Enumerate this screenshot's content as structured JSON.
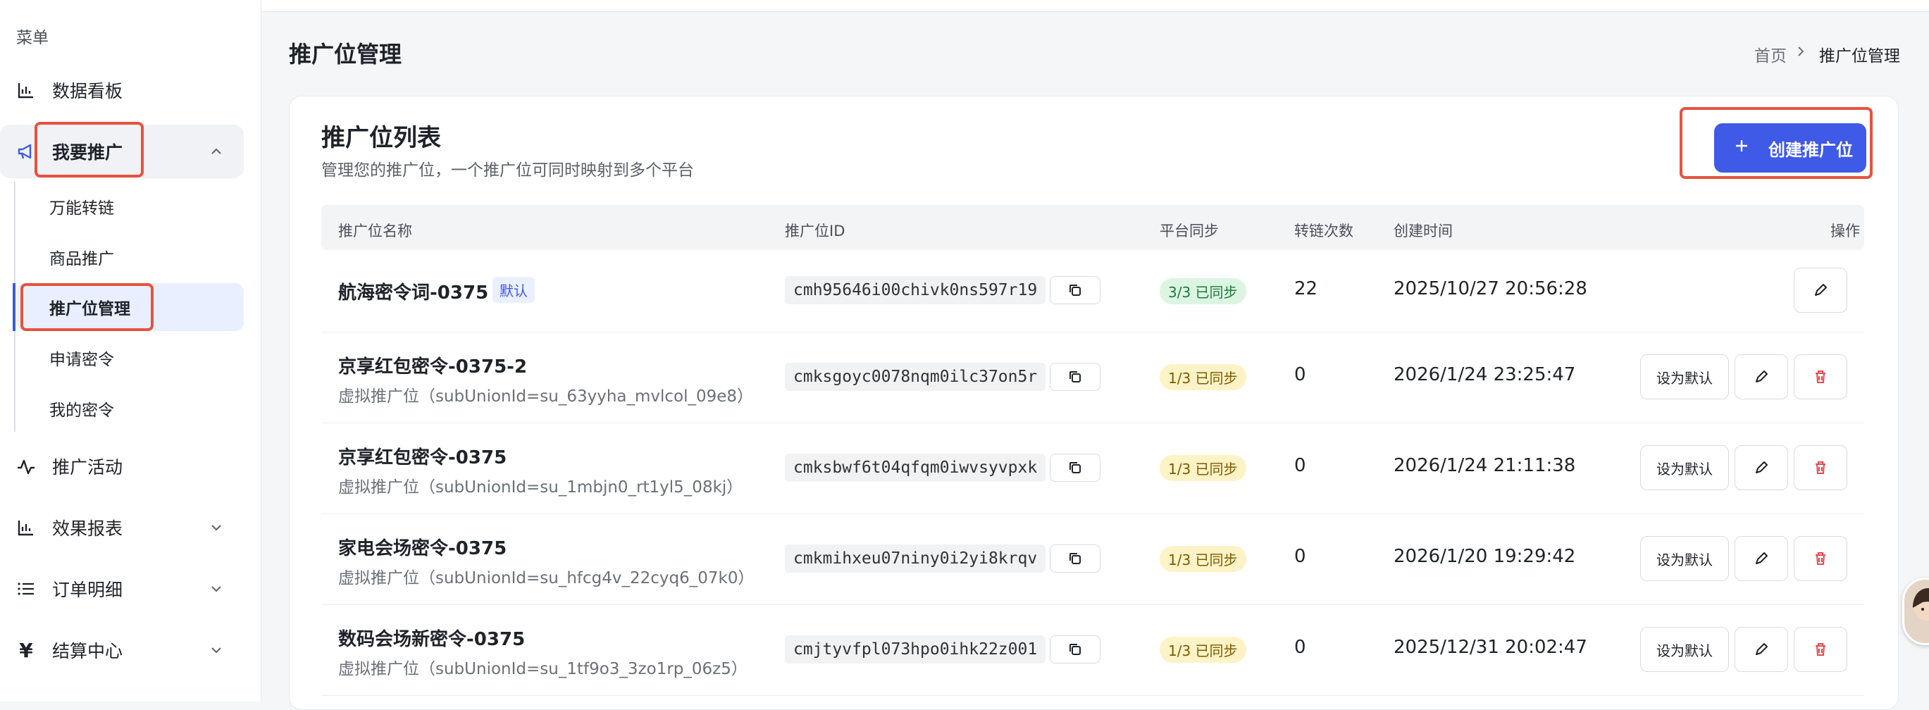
{
  "sidebar": {
    "menu_title": "菜单",
    "items": [
      {
        "label": "数据看板",
        "icon": "bar-chart-icon"
      },
      {
        "label": "我要推广",
        "icon": "megaphone-icon"
      },
      {
        "label": "推广活动",
        "icon": "activity-icon"
      },
      {
        "label": "效果报表",
        "icon": "bar-chart-icon"
      },
      {
        "label": "订单明细",
        "icon": "list-icon"
      },
      {
        "label": "结算中心",
        "icon": "yen-icon"
      }
    ],
    "sub_items": [
      "万能转链",
      "商品推广",
      "推广位管理",
      "申请密令",
      "我的密令"
    ]
  },
  "header": {
    "title": "推广位管理",
    "breadcrumb": {
      "home": "首页",
      "current": "推广位管理"
    }
  },
  "card": {
    "title": "推广位列表",
    "subtitle": "管理您的推广位，一个推广位可同时映射到多个平台",
    "create_button": "创建推广位",
    "columns": [
      "推广位名称",
      "推广位ID",
      "平台同步",
      "转链次数",
      "创建时间",
      "操作"
    ],
    "rows": [
      {
        "name": "航海密令词-0375",
        "badge": "默认",
        "sub": "",
        "id": "cmh95646i00chivk0ns597r19",
        "sync": "3/3 已同步",
        "count": "22",
        "time": "2025/10/27 20:56:28"
      },
      {
        "name": "京享红包密令-0375-2",
        "badge": "",
        "sub": "虚拟推广位（subUnionId=su_63yyha_mvlcol_09e8）",
        "id": "cmksgoyc0078nqm0ilc37on5r",
        "sync": "1/3 已同步",
        "count": "0",
        "time": "2026/1/24 23:25:47"
      },
      {
        "name": "京享红包密令-0375",
        "badge": "",
        "sub": "虚拟推广位（subUnionId=su_1mbjn0_rt1yl5_08kj）",
        "id": "cmksbwf6t04qfqm0iwvsyvpxk",
        "sync": "1/3 已同步",
        "count": "0",
        "time": "2026/1/24 21:11:38"
      },
      {
        "name": "家电会场密令-0375",
        "badge": "",
        "sub": "虚拟推广位（subUnionId=su_hfcg4v_22cyq6_07k0）",
        "id": "cmkmihxeu07niny0i2yi8krqv",
        "sync": "1/3 已同步",
        "count": "0",
        "time": "2026/1/20 19:29:42"
      },
      {
        "name": "数码会场新密令-0375",
        "badge": "",
        "sub": "虚拟推广位（subUnionId=su_1tf9o3_3zo1rp_06z5）",
        "id": "cmjtyvfpl073hpo0ihk22z001",
        "sync": "1/3 已同步",
        "count": "0",
        "time": "2025/12/31 20:02:47"
      }
    ],
    "set_default_label": "设为默认"
  },
  "colors": {
    "accent": "#3f5ae6",
    "highlight": "#e5533f",
    "danger": "#e5484d"
  }
}
